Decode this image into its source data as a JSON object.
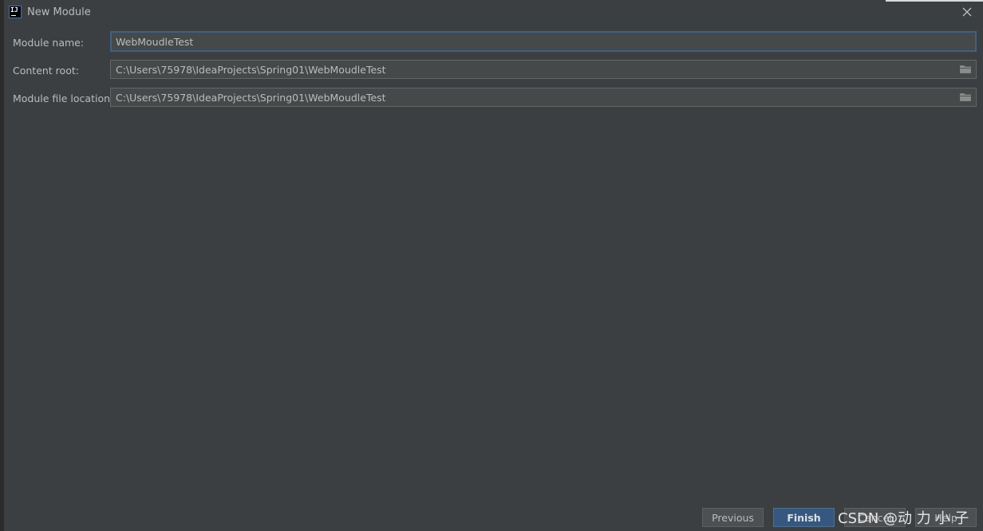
{
  "window": {
    "title": "New Module",
    "close_icon": "close-icon",
    "app_icon_text": "IJ"
  },
  "form": {
    "module_name": {
      "label": "Module name:",
      "value": "WebMoudleTest"
    },
    "content_root": {
      "label": "Content root:",
      "value": "C:\\Users\\75978\\IdeaProjects\\Spring01\\WebMoudleTest",
      "icon": "folder-icon"
    },
    "module_file_location": {
      "label": "Module file location:",
      "value": "C:\\Users\\75978\\IdeaProjects\\Spring01\\WebMoudleTest",
      "icon": "folder-icon"
    }
  },
  "buttons": {
    "previous": "Previous",
    "finish": "Finish",
    "cancel": "Cancel",
    "help": "Help"
  },
  "watermark": "CSDN @动 力 小 子",
  "colors": {
    "background": "#3c3f41",
    "field_background": "#45494a",
    "focus_border": "#3d6185",
    "primary_button": "#365880"
  }
}
